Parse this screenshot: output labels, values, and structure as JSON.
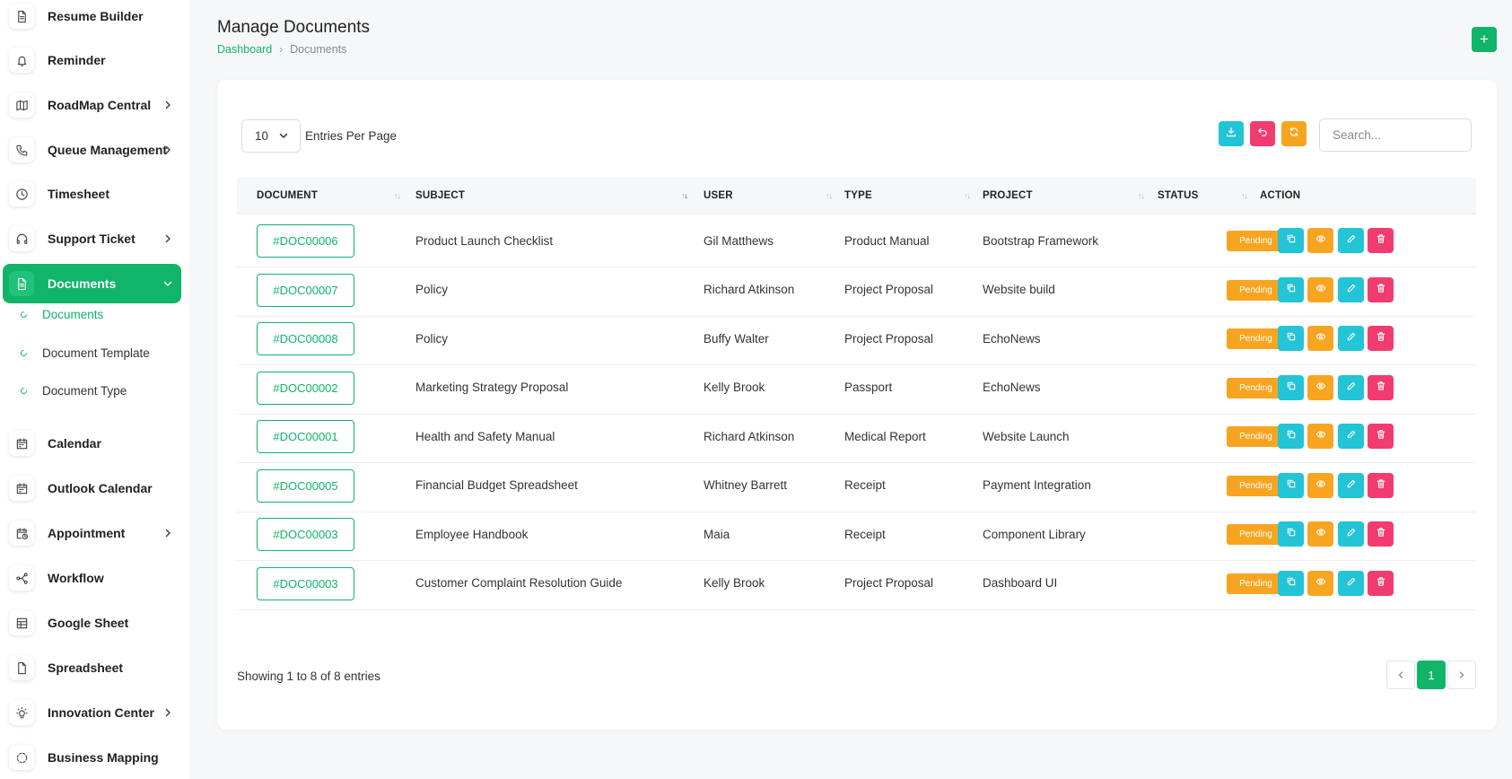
{
  "sidebar": {
    "items": [
      {
        "label": "Resume Builder",
        "icon": "file-text-icon",
        "chevron": false
      },
      {
        "label": "Reminder",
        "icon": "bell-icon",
        "chevron": false
      },
      {
        "label": "RoadMap Central",
        "icon": "map-icon",
        "chevron": true
      },
      {
        "label": "Queue Management",
        "icon": "phone-icon",
        "chevron": true
      },
      {
        "label": "Timesheet",
        "icon": "clock-icon",
        "chevron": false
      },
      {
        "label": "Support Ticket",
        "icon": "headset-icon",
        "chevron": true
      },
      {
        "label": "Documents",
        "icon": "file-text-icon",
        "chevron": true,
        "active": true
      },
      {
        "label": "Calendar",
        "icon": "calendar-icon",
        "chevron": false
      },
      {
        "label": "Outlook Calendar",
        "icon": "calendar-icon",
        "chevron": false
      },
      {
        "label": "Appointment",
        "icon": "calendar-clock-icon",
        "chevron": true
      },
      {
        "label": "Workflow",
        "icon": "workflow-icon",
        "chevron": false
      },
      {
        "label": "Google Sheet",
        "icon": "table-icon",
        "chevron": false
      },
      {
        "label": "Spreadsheet",
        "icon": "file-icon",
        "chevron": false
      },
      {
        "label": "Innovation Center",
        "icon": "lightbulb-icon",
        "chevron": true
      },
      {
        "label": "Business Mapping",
        "icon": "circle-dashed-icon",
        "chevron": false
      }
    ],
    "sub_items": [
      {
        "label": "Documents",
        "active": true
      },
      {
        "label": "Document Template",
        "active": false
      },
      {
        "label": "Document Type",
        "active": false
      }
    ]
  },
  "header": {
    "title": "Manage Documents",
    "breadcrumb": {
      "home": "Dashboard",
      "separator": "›",
      "current": "Documents"
    },
    "add_label": "+"
  },
  "controls": {
    "entries_value": "10",
    "entries_label": "Entries Per Page",
    "search_placeholder": "Search..."
  },
  "table": {
    "columns": [
      "DOCUMENT",
      "SUBJECT",
      "USER",
      "TYPE",
      "PROJECT",
      "STATUS",
      "ACTION"
    ],
    "rows": [
      {
        "id": "#DOC00006",
        "subject": "Product Launch Checklist",
        "user": "Gil Matthews",
        "type": "Product Manual",
        "project": "Bootstrap Framework",
        "status": "Pending"
      },
      {
        "id": "#DOC00007",
        "subject": "Policy",
        "user": "Richard Atkinson",
        "type": "Project Proposal",
        "project": "Website build",
        "status": "Pending"
      },
      {
        "id": "#DOC00008",
        "subject": "Policy",
        "user": "Buffy Walter",
        "type": "Project Proposal",
        "project": "EchoNews",
        "status": "Pending"
      },
      {
        "id": "#DOC00002",
        "subject": "Marketing Strategy Proposal",
        "user": "Kelly Brook",
        "type": "Passport",
        "project": "EchoNews",
        "status": "Pending"
      },
      {
        "id": "#DOC00001",
        "subject": "Health and Safety Manual",
        "user": "Richard Atkinson",
        "type": "Medical Report",
        "project": "Website Launch",
        "status": "Pending"
      },
      {
        "id": "#DOC00005",
        "subject": "Financial Budget Spreadsheet",
        "user": "Whitney Barrett",
        "type": "Receipt",
        "project": "Payment Integration",
        "status": "Pending"
      },
      {
        "id": "#DOC00003",
        "subject": "Employee Handbook",
        "user": "Maia",
        "type": "Receipt",
        "project": "Component Library",
        "status": "Pending"
      },
      {
        "id": "#DOC00003",
        "subject": "Customer Complaint Resolution Guide",
        "user": "Kelly Brook",
        "type": "Project Proposal",
        "project": "Dashboard UI",
        "status": "Pending"
      }
    ]
  },
  "footer": {
    "showing": "Showing 1 to 8 of 8 entries",
    "current_page": "1"
  },
  "colors": {
    "primary": "#10b569",
    "cyan": "#22c4d6",
    "orange": "#f7a521",
    "pink": "#f23c6f"
  }
}
